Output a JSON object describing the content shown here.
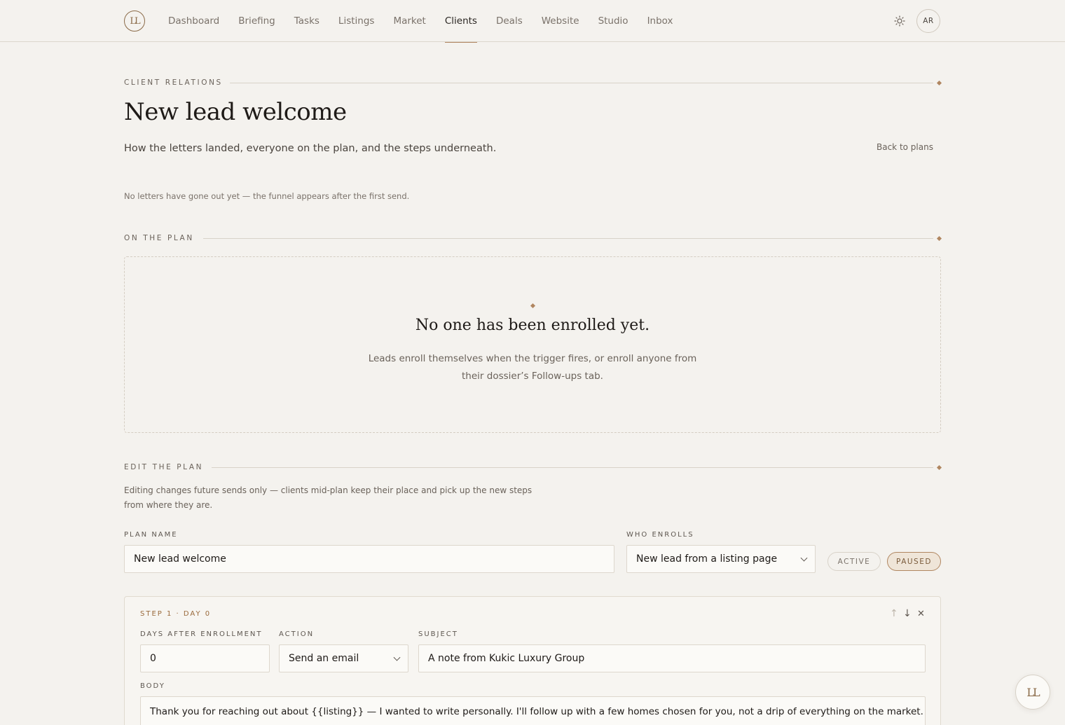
{
  "nav": {
    "logo": "LL",
    "items": [
      "Dashboard",
      "Briefing",
      "Tasks",
      "Listings",
      "Market",
      "Clients",
      "Deals",
      "Website",
      "Studio",
      "Inbox"
    ],
    "active": "Clients",
    "avatar": "AR"
  },
  "header": {
    "eyebrow": "CLIENT RELATIONS",
    "title": "New lead welcome",
    "subtitle": "How the letters landed, everyone on the plan, and the steps underneath.",
    "back_link": "Back to plans",
    "funnel_note": "No letters have gone out yet — the funnel appears after the first send."
  },
  "on_plan": {
    "label": "ON THE PLAN",
    "empty_title": "No one has been enrolled yet.",
    "empty_text": "Leads enroll themselves when the trigger fires, or enroll anyone from their dossier’s Follow-ups tab."
  },
  "edit": {
    "label": "EDIT THE PLAN",
    "note": "Editing changes future sends only — clients mid-plan keep their place and pick up the new steps from where they are.",
    "plan_name_label": "PLAN NAME",
    "plan_name_value": "New lead welcome",
    "who_enrolls_label": "WHO ENROLLS",
    "who_enrolls_value": "New lead from a listing page",
    "status_active": "ACTIVE",
    "status_paused": "PAUSED",
    "status_selected": "PAUSED"
  },
  "step": {
    "title": "STEP 1 · DAY 0",
    "days_label": "DAYS AFTER ENROLLMENT",
    "days_value": "0",
    "action_label": "ACTION",
    "action_value": "Send an email",
    "subject_label": "SUBJECT",
    "subject_value": "A note from Kukic Luxury Group",
    "body_label": "BODY",
    "body_value": "Thank you for reaching out about {{listing}} — I wanted to write personally. I'll follow up with a few homes chosen for you, not a drip of everything on the market.",
    "up": "↑",
    "down": "↓",
    "remove": "✕"
  },
  "fab": "LL",
  "colors": {
    "accent": "#b08660",
    "background": "#f4f2ee"
  }
}
